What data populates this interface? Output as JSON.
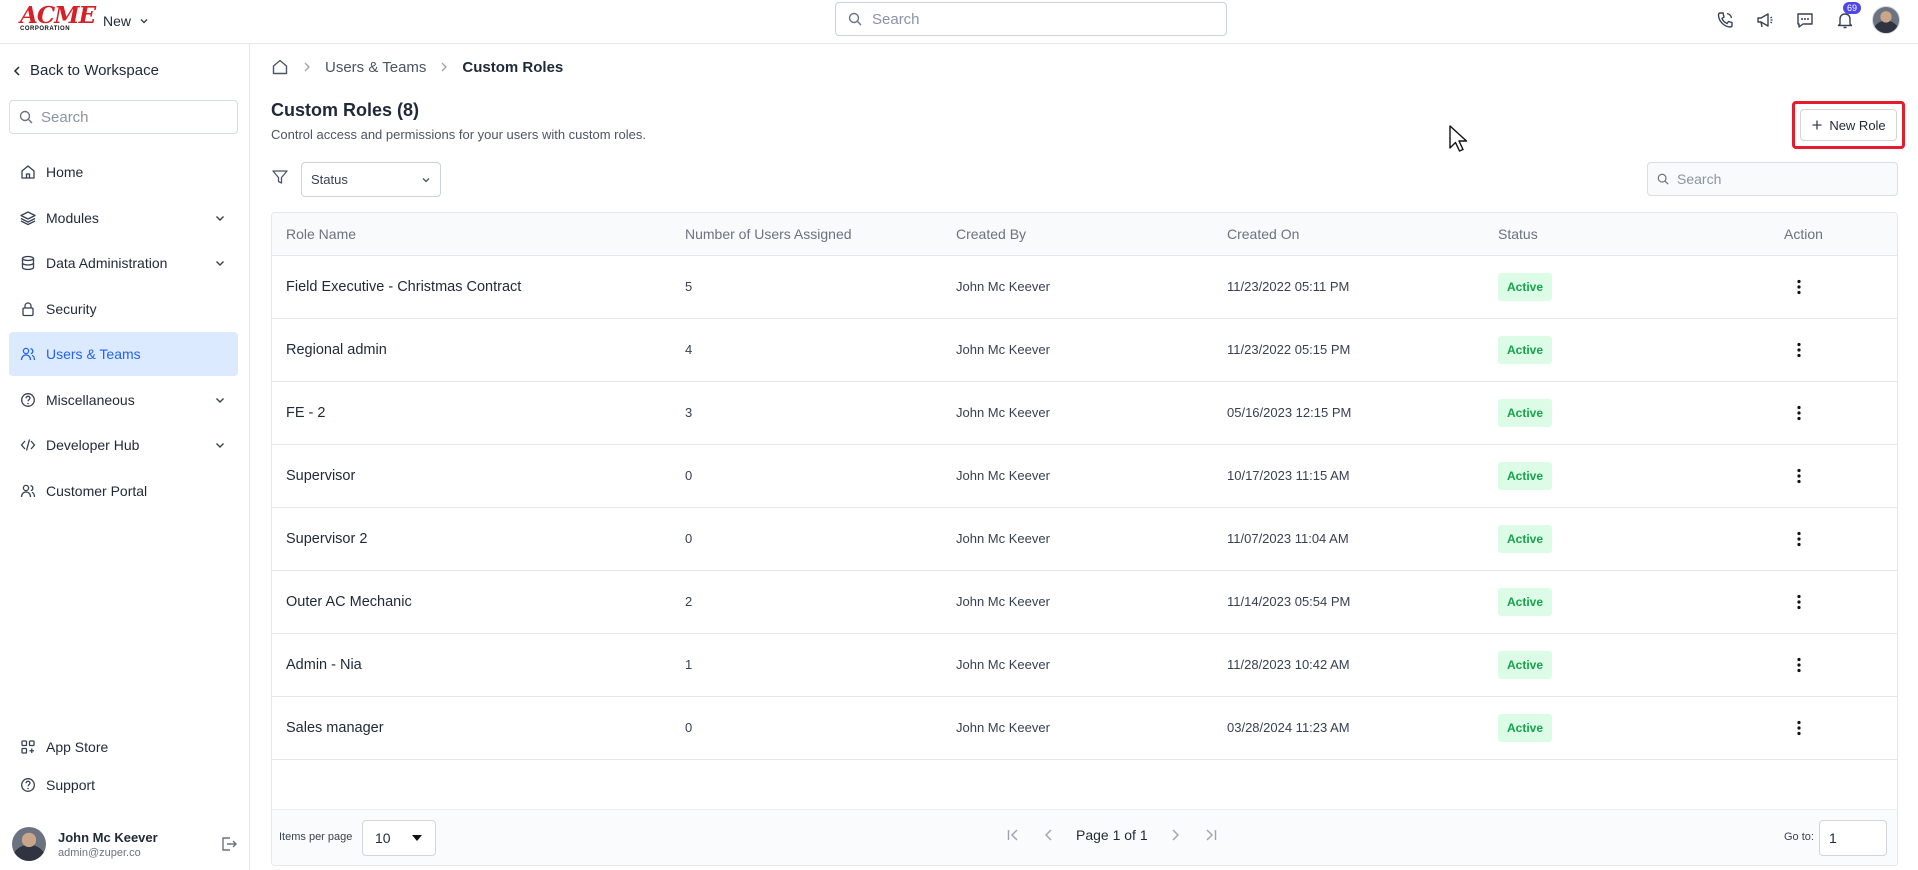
{
  "brand": {
    "logo_word": "ACME",
    "logo_sub": "CORPORATION"
  },
  "topbar": {
    "new_label": "New",
    "search_placeholder": "Search",
    "notification_count": "69",
    "icons": [
      "phone-icon",
      "megaphone-icon",
      "chat-icon",
      "bell-icon"
    ]
  },
  "sidebar": {
    "back_label": "Back to Workspace",
    "search_placeholder": "Search",
    "items": [
      {
        "label": "Home",
        "icon": "home-icon"
      },
      {
        "label": "Modules",
        "icon": "layers-icon"
      },
      {
        "label": "Data Administration",
        "icon": "database-icon"
      },
      {
        "label": "Security",
        "icon": "lock-icon"
      },
      {
        "label": "Users & Teams",
        "icon": "users-icon",
        "active": true
      },
      {
        "label": "Miscellaneous",
        "icon": "help-circle-icon"
      },
      {
        "label": "Developer Hub",
        "icon": "code-icon"
      },
      {
        "label": "Customer Portal",
        "icon": "users-icon"
      }
    ],
    "bottom_items": [
      {
        "label": "App Store",
        "icon": "apps-icon"
      },
      {
        "label": "Support",
        "icon": "help-circle-icon"
      }
    ],
    "user": {
      "name": "John Mc Keever",
      "email": "admin@zuper.co"
    }
  },
  "breadcrumb": {
    "parent": "Users & Teams",
    "current": "Custom Roles"
  },
  "page": {
    "title": "Custom Roles (8)",
    "subtitle": "Control access and permissions for your users with custom roles.",
    "new_role_label": "New Role",
    "status_filter": "Status",
    "table_search_placeholder": "Search"
  },
  "table": {
    "columns": [
      "Role Name",
      "Number of Users Assigned",
      "Created By",
      "Created On",
      "Status",
      "Action"
    ],
    "rows": [
      {
        "name": "Field Executive - Christmas Contract",
        "users": "5",
        "created_by": "John Mc Keever",
        "created_on": "11/23/2022 05:11 PM",
        "status": "Active"
      },
      {
        "name": "Regional admin",
        "users": "4",
        "created_by": "John Mc Keever",
        "created_on": "11/23/2022 05:15 PM",
        "status": "Active"
      },
      {
        "name": "FE - 2",
        "users": "3",
        "created_by": "John Mc Keever",
        "created_on": "05/16/2023 12:15 PM",
        "status": "Active"
      },
      {
        "name": "Supervisor",
        "users": "0",
        "created_by": "John Mc Keever",
        "created_on": "10/17/2023 11:15 AM",
        "status": "Active"
      },
      {
        "name": "Supervisor 2",
        "users": "0",
        "created_by": "John Mc Keever",
        "created_on": "11/07/2023 11:04 AM",
        "status": "Active"
      },
      {
        "name": "Outer AC Mechanic",
        "users": "2",
        "created_by": "John Mc Keever",
        "created_on": "11/14/2023 05:54 PM",
        "status": "Active"
      },
      {
        "name": "Admin - Nia",
        "users": "1",
        "created_by": "John Mc Keever",
        "created_on": "11/28/2023 10:42 AM",
        "status": "Active"
      },
      {
        "name": "Sales manager",
        "users": "0",
        "created_by": "John Mc Keever",
        "created_on": "03/28/2024 11:23 AM",
        "status": "Active"
      }
    ]
  },
  "pagination": {
    "items_per_page_label": "Items per page",
    "items_per_page": "10",
    "page_text": "Page 1 of 1",
    "goto_label": "Go to:",
    "goto_value": "1"
  },
  "colors": {
    "accent": "#2563eb",
    "active_nav_bg": "#dbeafe",
    "status_active_bg": "#dcfce7",
    "status_active_text": "#16a34a",
    "highlight": "#e11d2e",
    "brand_red": "#d61f26"
  }
}
